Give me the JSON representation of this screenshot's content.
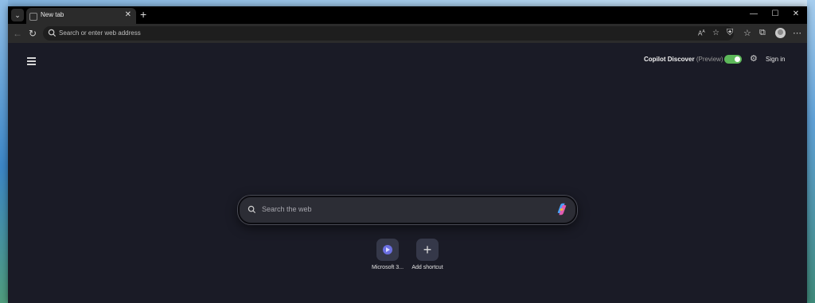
{
  "tab": {
    "title": "New tab"
  },
  "address_bar": {
    "placeholder": "Search or enter web address"
  },
  "header": {
    "copilot_label": "Copilot Discover",
    "copilot_preview": "(Preview)",
    "copilot_toggle_on": true,
    "sign_in": "Sign in"
  },
  "search": {
    "placeholder": "Search the web"
  },
  "shortcuts": [
    {
      "label": "Microsoft 3..."
    },
    {
      "label": "Add shortcut"
    }
  ],
  "colors": {
    "toggle": "#5db85a",
    "page_bg": "#1a1b26",
    "accent": "#6b6fe0"
  }
}
